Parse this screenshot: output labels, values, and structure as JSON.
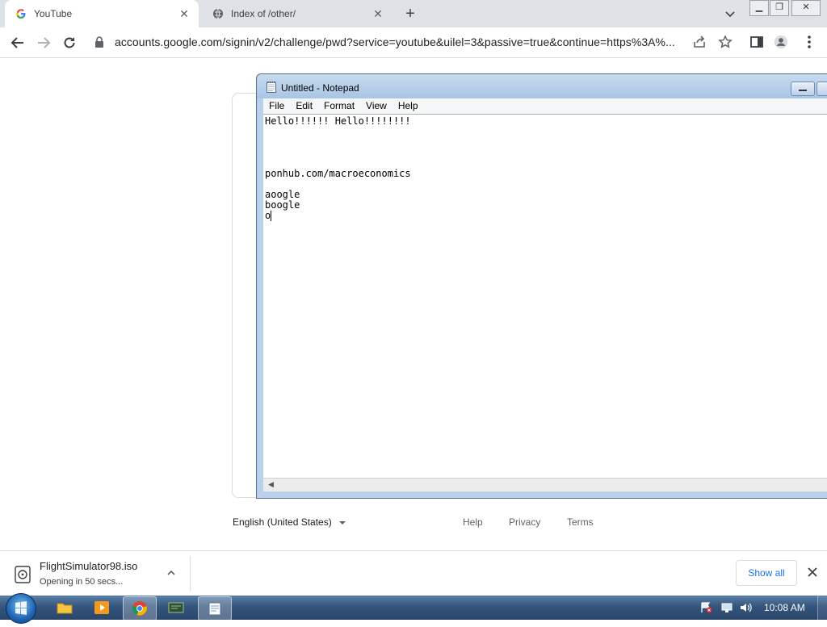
{
  "browser": {
    "tabs": [
      {
        "title": "YouTube",
        "favicon": "google-g-icon",
        "active": true
      },
      {
        "title": "Index of /other/",
        "favicon": "globe-icon",
        "active": false
      }
    ],
    "url": "accounts.google.com/signin/v2/challenge/pwd?service=youtube&uilel=3&passive=true&continue=https%3A%..."
  },
  "signin_page": {
    "language": "English (United States)",
    "footer_links": [
      "Help",
      "Privacy",
      "Terms"
    ]
  },
  "notepad": {
    "title": "Untitled - Notepad",
    "menu": [
      "File",
      "Edit",
      "Format",
      "View",
      "Help"
    ],
    "text": "Hello!!!!!! Hello!!!!!!!!\n\n\n\n\nponhub.com/macroeconomics\n\naoogle\nboogle\no"
  },
  "download_shelf": {
    "file_name": "FlightSimulator98.iso",
    "status": "Opening in 50 secs...",
    "show_all": "Show all"
  },
  "taskbar": {
    "clock": "10:08 AM"
  },
  "colors": {
    "accent_blue": "#1a73e8",
    "tabstrip_bg": "#dee1e6",
    "taskbar": "#34557c"
  }
}
